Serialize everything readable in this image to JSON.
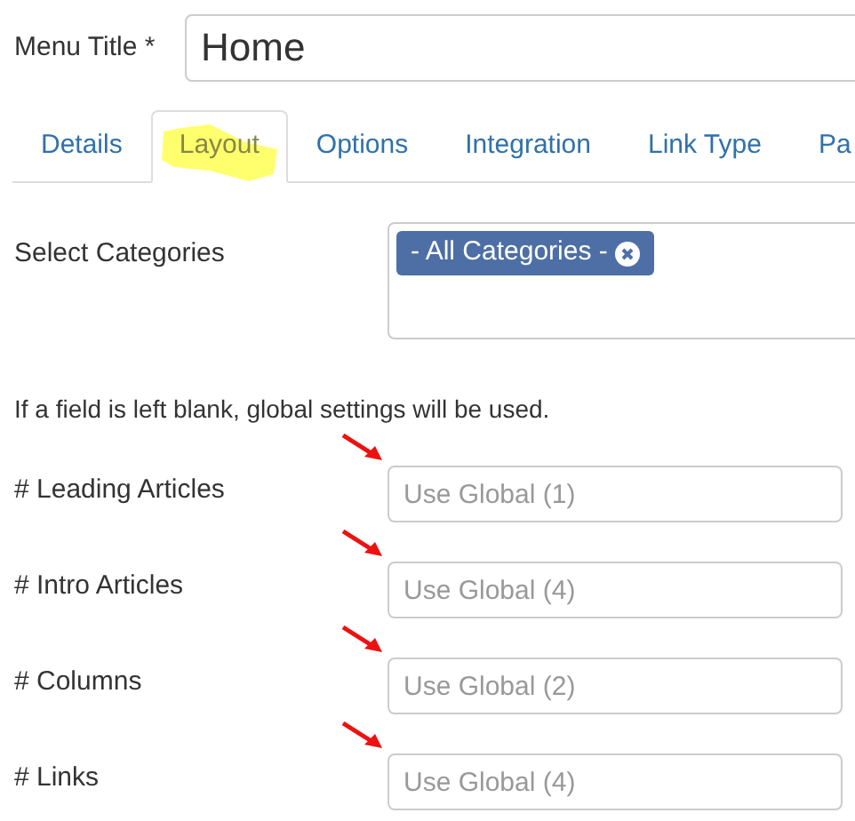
{
  "title_field": {
    "label": "Menu Title *",
    "value": "Home"
  },
  "tabs": [
    {
      "label": "Details",
      "selected": false,
      "highlighted": false
    },
    {
      "label": "Layout",
      "selected": true,
      "highlighted": true
    },
    {
      "label": "Options",
      "selected": false,
      "highlighted": false
    },
    {
      "label": "Integration",
      "selected": false,
      "highlighted": false
    },
    {
      "label": "Link Type",
      "selected": false,
      "highlighted": false
    },
    {
      "label": "Pa",
      "selected": false,
      "highlighted": false
    }
  ],
  "categories": {
    "label": "Select Categories",
    "chips": [
      "- All Categories -"
    ]
  },
  "note": "If a field is left blank, global settings will be used.",
  "fields": [
    {
      "label": "# Leading Articles",
      "placeholder": "Use Global (1)",
      "arrow": true
    },
    {
      "label": "# Intro Articles",
      "placeholder": "Use Global (4)",
      "arrow": true
    },
    {
      "label": "# Columns",
      "placeholder": "Use Global (2)",
      "arrow": true
    },
    {
      "label": "# Links",
      "placeholder": "Use Global (4)",
      "arrow": true
    }
  ]
}
